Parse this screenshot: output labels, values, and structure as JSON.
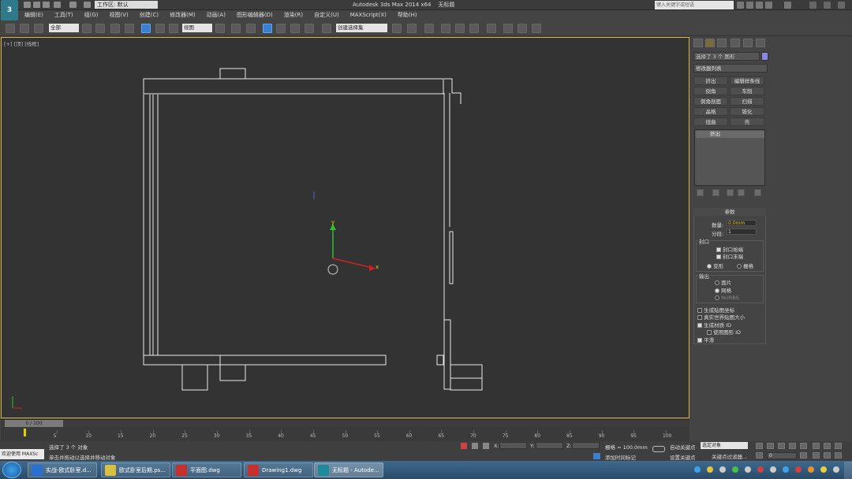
{
  "app": {
    "title": "Autodesk 3ds Max  2014 x64",
    "doc": "无标题",
    "workspace": "工作区: 默认",
    "search_placeholder": "键入关键字或短语"
  },
  "menu": [
    "编辑(E)",
    "工具(T)",
    "组(G)",
    "视图(V)",
    "创建(C)",
    "修改器(M)",
    "动画(A)",
    "图形编辑器(D)",
    "渲染(R)",
    "自定义(U)",
    "MAXScript(X)",
    "帮助(H)"
  ],
  "toolbar": {
    "filter": "全部",
    "refcoord": "视图",
    "namedsel": "创建选择集"
  },
  "viewport": {
    "label": "[+] [顶] [线框]",
    "axis_y": "y",
    "axis_x": "x"
  },
  "panel": {
    "object_name": "选择了 3 个 图形",
    "modifier_list": "修改器列表",
    "mod_buttons": [
      "挤出",
      "编辑样条线",
      "倒角",
      "车削",
      "倒角剖面",
      "扫描",
      "晶格",
      "锥化",
      "扭曲",
      "壳"
    ],
    "stack_item": "挤出",
    "params_title": "参数",
    "amount_label": "数量:",
    "amount_value": "0.0mm",
    "segments_label": "分段:",
    "segments_value": "1",
    "capping_title": "封口",
    "cap_start": "封口始端",
    "cap_end": "封口末端",
    "morph": "变形",
    "grid_opt": "栅格",
    "output_title": "输出",
    "out_patch": "面片",
    "out_mesh": "网格",
    "out_nurbs": "NURBS",
    "gen_map": "生成贴图坐标",
    "real_world": "真实世界贴图大小",
    "gen_mat": "生成材质 ID",
    "use_shape": "使用图形 ID",
    "smooth": "平滑"
  },
  "timeline": {
    "slider": "0 / 100",
    "ticks": [
      5,
      10,
      15,
      20,
      25,
      30,
      35,
      40,
      45,
      50,
      55,
      60,
      65,
      70,
      75,
      80,
      85,
      90,
      95,
      100
    ]
  },
  "status": {
    "welcome": "欢迎使用 MAXSc",
    "line1": "选择了 3 个 对象",
    "line2": "单击并拖动以选择并移动对象",
    "x": "X:",
    "y": "Y:",
    "z": "Z:",
    "grid": "栅格 = 100.0mm",
    "add_time_tag": "添加时间标记",
    "auto_key": "自动关键点",
    "set_key": "设置关键点",
    "selected": "选定对象",
    "key_filters": "关键点过滤器...",
    "frame": "0"
  },
  "taskbar": [
    {
      "label": "实战-欧式卧室.d...",
      "color": "#2b6fd0"
    },
    {
      "label": "欧式卧室后期.ps...",
      "color": "#d8c040"
    },
    {
      "label": "平面图.dwg",
      "color": "#c83030"
    },
    {
      "label": "Drawing1.dwg",
      "color": "#c83030"
    },
    {
      "label": "无标题 - Autode...",
      "color": "#1e8a9a"
    }
  ],
  "colors": {
    "viewport_border": "#d6b24a",
    "active_button": "#3a7fd0",
    "gizmo_y": "#2fbf2f",
    "gizmo_x": "#d02020"
  }
}
